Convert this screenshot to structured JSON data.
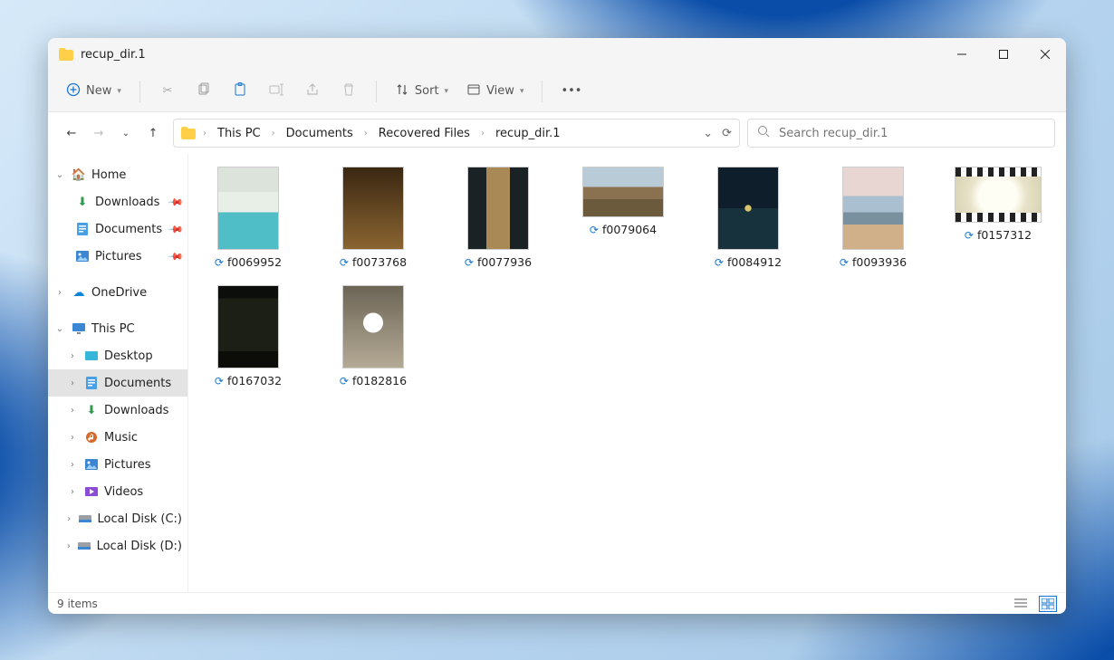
{
  "window": {
    "title": "recup_dir.1"
  },
  "toolbar": {
    "new": "New",
    "sort": "Sort",
    "view": "View"
  },
  "breadcrumbs": [
    "This PC",
    "Documents",
    "Recovered Files",
    "recup_dir.1"
  ],
  "search": {
    "placeholder": "Search recup_dir.1"
  },
  "sidebar": {
    "home": "Home",
    "downloads": "Downloads",
    "documents": "Documents",
    "pictures": "Pictures",
    "onedrive": "OneDrive",
    "thispc": "This PC",
    "desktop": "Desktop",
    "documents2": "Documents",
    "downloads2": "Downloads",
    "music": "Music",
    "pictures2": "Pictures",
    "videos": "Videos",
    "localc": "Local Disk (C:)",
    "locald": "Local Disk (D:)"
  },
  "files": [
    {
      "name": "f0069952",
      "kind": "image",
      "shape": "tall",
      "thumb": "tA"
    },
    {
      "name": "f0073768",
      "kind": "image",
      "shape": "tall",
      "thumb": "tB"
    },
    {
      "name": "f0077936",
      "kind": "image",
      "shape": "tall",
      "thumb": "tC"
    },
    {
      "name": "f0079064",
      "kind": "image",
      "shape": "wide",
      "thumb": "tD"
    },
    {
      "name": "f0084912",
      "kind": "image",
      "shape": "tall",
      "thumb": "tE"
    },
    {
      "name": "f0093936",
      "kind": "image",
      "shape": "tall",
      "thumb": "tF"
    },
    {
      "name": "f0157312",
      "kind": "video",
      "shape": "vid",
      "thumb": "tG"
    },
    {
      "name": "f0167032",
      "kind": "image",
      "shape": "tall",
      "thumb": "tH"
    },
    {
      "name": "f0182816",
      "kind": "image",
      "shape": "tall",
      "thumb": "tI"
    }
  ],
  "status": {
    "count": "9 items"
  }
}
